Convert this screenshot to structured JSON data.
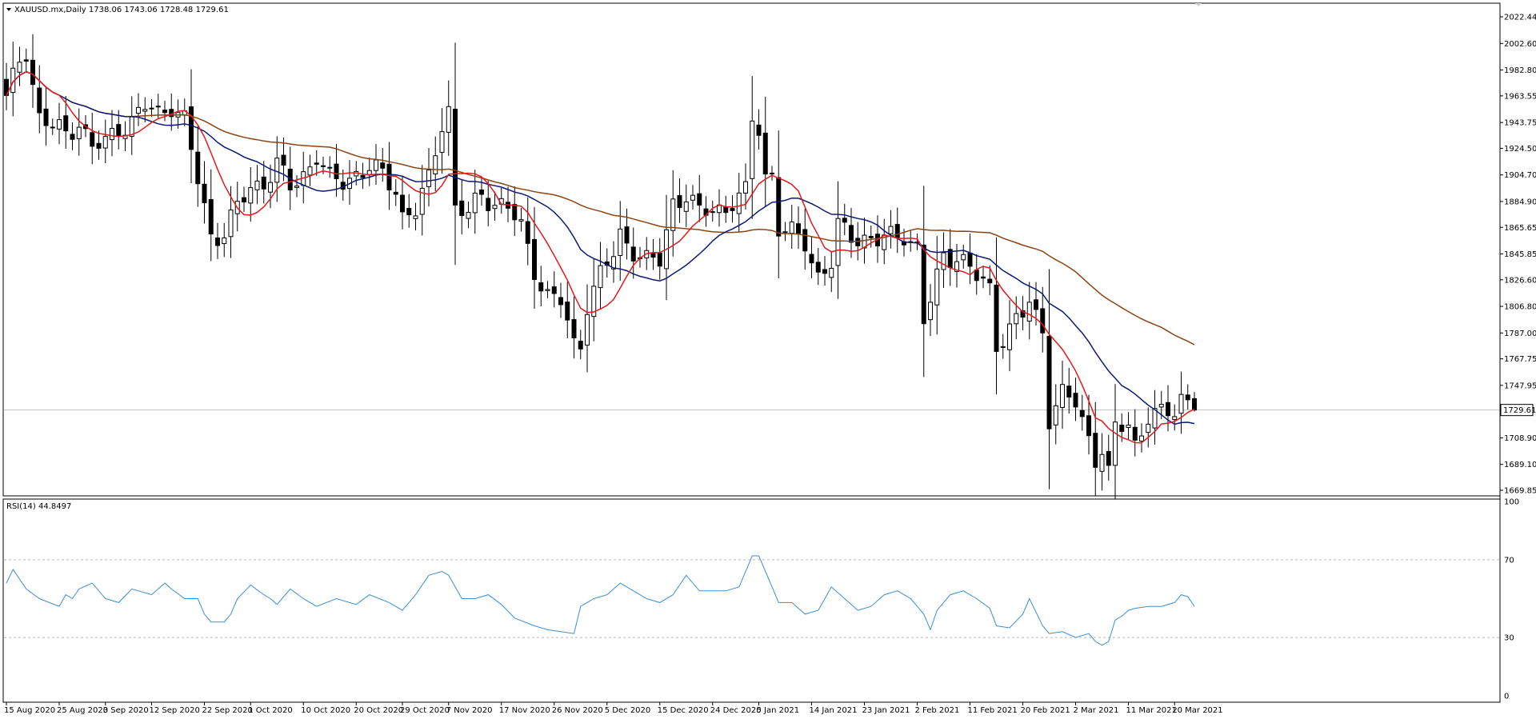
{
  "header": {
    "symbol_line": "XAUUSD.mx,Daily  1738.06 1743.06 1728.48 1729.61",
    "rsi_line": "RSI(14) 44.8497"
  },
  "colors": {
    "background": "#ffffff",
    "frame": "#000000",
    "ma_fast": "#e31a1c",
    "ma_mid": "#0c1a73",
    "ma_slow": "#8b4513",
    "rsi_line": "#3b8fd4",
    "current_price_line": "#c0c0c0",
    "bull_body": "#ffffff",
    "bear_body": "#000000"
  },
  "chart_data": [
    {
      "type": "candlestick",
      "symbol": "XAUUSD.mx",
      "timeframe": "Daily",
      "last_bar": {
        "open": 1738.06,
        "high": 1743.06,
        "low": 1728.48,
        "close": 1729.61
      },
      "current_price_label": "1729.61",
      "ylim": [
        1669.85,
        2022.44
      ],
      "y_ticks": [
        "2022.44",
        "2002.60",
        "1982.80",
        "1963.55",
        "1943.75",
        "1924.50",
        "1904.70",
        "1884.90",
        "1865.65",
        "1845.85",
        "1826.60",
        "1806.80",
        "1787.00",
        "1767.75",
        "1747.95",
        "1729.61",
        "1708.90",
        "1689.10",
        "1669.85"
      ],
      "x_ticks": [
        {
          "index": 0,
          "label": "15 Aug 2020"
        },
        {
          "index": 8,
          "label": "25 Aug 2020"
        },
        {
          "index": 15,
          "label": "3 Sep 2020"
        },
        {
          "index": 22,
          "label": "12 Sep 2020"
        },
        {
          "index": 30,
          "label": "22 Sep 2020"
        },
        {
          "index": 37,
          "label": "1 Oct 2020"
        },
        {
          "index": 45,
          "label": "10 Oct 2020"
        },
        {
          "index": 53,
          "label": "20 Oct 2020"
        },
        {
          "index": 60,
          "label": "29 Oct 2020"
        },
        {
          "index": 67,
          "label": "7 Nov 2020"
        },
        {
          "index": 75,
          "label": "17 Nov 2020"
        },
        {
          "index": 83,
          "label": "26 Nov 2020"
        },
        {
          "index": 91,
          "label": "5 Dec 2020"
        },
        {
          "index": 99,
          "label": "15 Dec 2020"
        },
        {
          "index": 107,
          "label": "24 Dec 2020"
        },
        {
          "index": 114,
          "label": "5 Jan 2021"
        },
        {
          "index": 122,
          "label": "14 Jan 2021"
        },
        {
          "index": 130,
          "label": "23 Jan 2021"
        },
        {
          "index": 138,
          "label": "2 Feb 2021"
        },
        {
          "index": 146,
          "label": "11 Feb 2021"
        },
        {
          "index": 154,
          "label": "20 Feb 2021"
        },
        {
          "index": 162,
          "label": "2 Mar 2021"
        },
        {
          "index": 170,
          "label": "11 Mar 2021"
        },
        {
          "index": 177,
          "label": "20 Mar 2021"
        }
      ],
      "close_path": [
        [
          0,
          1960
        ],
        [
          2,
          1990
        ],
        [
          3,
          1998
        ],
        [
          5,
          1948
        ],
        [
          7,
          1940
        ],
        [
          9,
          1935
        ],
        [
          11,
          1945
        ],
        [
          13,
          1925
        ],
        [
          15,
          1928
        ],
        [
          17,
          1940
        ],
        [
          19,
          1945
        ],
        [
          21,
          1955
        ],
        [
          23,
          1950
        ],
        [
          25,
          1958
        ],
        [
          27,
          1945
        ],
        [
          29,
          1900
        ],
        [
          31,
          1860
        ],
        [
          33,
          1862
        ],
        [
          35,
          1880
        ],
        [
          37,
          1895
        ],
        [
          39,
          1900
        ],
        [
          41,
          1912
        ],
        [
          43,
          1895
        ],
        [
          45,
          1905
        ],
        [
          47,
          1920
        ],
        [
          49,
          1900
        ],
        [
          51,
          1900
        ],
        [
          53,
          1906
        ],
        [
          55,
          1910
        ],
        [
          57,
          1904
        ],
        [
          59,
          1895
        ],
        [
          60,
          1875
        ],
        [
          62,
          1878
        ],
        [
          64,
          1900
        ],
        [
          66,
          1945
        ],
        [
          67,
          1955
        ],
        [
          68,
          1880
        ],
        [
          70,
          1875
        ],
        [
          72,
          1890
        ],
        [
          74,
          1885
        ],
        [
          76,
          1880
        ],
        [
          78,
          1865
        ],
        [
          80,
          1835
        ],
        [
          82,
          1815
        ],
        [
          84,
          1810
        ],
        [
          86,
          1778
        ],
        [
          87,
          1780
        ],
        [
          88,
          1810
        ],
        [
          90,
          1830
        ],
        [
          92,
          1845
        ],
        [
          93,
          1860
        ],
        [
          95,
          1850
        ],
        [
          97,
          1840
        ],
        [
          99,
          1840
        ],
        [
          101,
          1885
        ],
        [
          103,
          1890
        ],
        [
          105,
          1875
        ],
        [
          107,
          1880
        ],
        [
          109,
          1880
        ],
        [
          110,
          1885
        ],
        [
          112,
          1890
        ],
        [
          113,
          1945
        ],
        [
          114,
          1940
        ],
        [
          115,
          1905
        ],
        [
          116,
          1905
        ],
        [
          117,
          1865
        ],
        [
          119,
          1860
        ],
        [
          121,
          1855
        ],
        [
          123,
          1830
        ],
        [
          125,
          1838
        ],
        [
          126,
          1865
        ],
        [
          128,
          1860
        ],
        [
          130,
          1858
        ],
        [
          132,
          1855
        ],
        [
          134,
          1858
        ],
        [
          136,
          1862
        ],
        [
          138,
          1850
        ],
        [
          139,
          1795
        ],
        [
          140,
          1810
        ],
        [
          142,
          1845
        ],
        [
          144,
          1845
        ],
        [
          145,
          1840
        ],
        [
          147,
          1828
        ],
        [
          149,
          1820
        ],
        [
          150,
          1780
        ],
        [
          152,
          1790
        ],
        [
          154,
          1800
        ],
        [
          155,
          1810
        ],
        [
          157,
          1790
        ],
        [
          158,
          1725
        ],
        [
          160,
          1740
        ],
        [
          162,
          1735
        ],
        [
          164,
          1710
        ],
        [
          165,
          1695
        ],
        [
          166,
          1700
        ],
        [
          167,
          1680
        ],
        [
          168,
          1715
        ],
        [
          170,
          1720
        ],
        [
          171,
          1705
        ],
        [
          173,
          1725
        ],
        [
          175,
          1725
        ],
        [
          177,
          1730
        ],
        [
          178,
          1740
        ],
        [
          179,
          1738
        ],
        [
          180,
          1729.61
        ]
      ]
    },
    {
      "type": "line",
      "name": "RSI(14)",
      "ylim": [
        0,
        100
      ],
      "y_ticks": [
        "100",
        "70",
        "30",
        "0"
      ],
      "levels": [
        70,
        30
      ],
      "x_index": [
        0,
        1,
        3,
        5,
        8,
        9,
        10,
        11,
        13,
        15,
        17,
        19,
        22,
        24,
        25,
        27,
        29,
        30,
        31,
        33,
        34,
        35,
        37,
        39,
        40,
        41,
        43,
        45,
        47,
        50,
        53,
        55,
        58,
        60,
        62,
        64,
        66,
        67,
        69,
        71,
        73,
        75,
        77,
        80,
        82,
        84,
        86,
        87,
        89,
        91,
        93,
        95,
        97,
        99,
        101,
        103,
        105,
        107,
        109,
        111,
        113,
        114,
        115,
        117,
        119,
        121,
        123,
        125,
        127,
        129,
        131,
        133,
        135,
        137,
        139,
        140,
        141,
        143,
        145,
        147,
        149,
        150,
        152,
        154,
        155,
        157,
        158,
        160,
        162,
        164,
        165,
        166,
        167,
        168,
        169,
        170,
        171,
        173,
        175,
        177,
        178,
        179,
        180
      ],
      "values": [
        58,
        65,
        55,
        50,
        46,
        52,
        50,
        55,
        58,
        50,
        48,
        55,
        52,
        58,
        55,
        50,
        50,
        42,
        38,
        38,
        42,
        50,
        57,
        52,
        50,
        47,
        55,
        50,
        46,
        50,
        47,
        52,
        48,
        44,
        52,
        62,
        64,
        62,
        50,
        50,
        52,
        47,
        40,
        36,
        34,
        33,
        32,
        46,
        50,
        52,
        58,
        54,
        50,
        48,
        52,
        62,
        54,
        54,
        54,
        56,
        72,
        72,
        64,
        48,
        48,
        42,
        44,
        56,
        50,
        44,
        46,
        52,
        54,
        50,
        42,
        34,
        44,
        52,
        54,
        50,
        45,
        36,
        35,
        42,
        50,
        36,
        32,
        33,
        30,
        32,
        28,
        26,
        28,
        39,
        41,
        44,
        45,
        46,
        46,
        48,
        52,
        51,
        46
      ]
    }
  ]
}
